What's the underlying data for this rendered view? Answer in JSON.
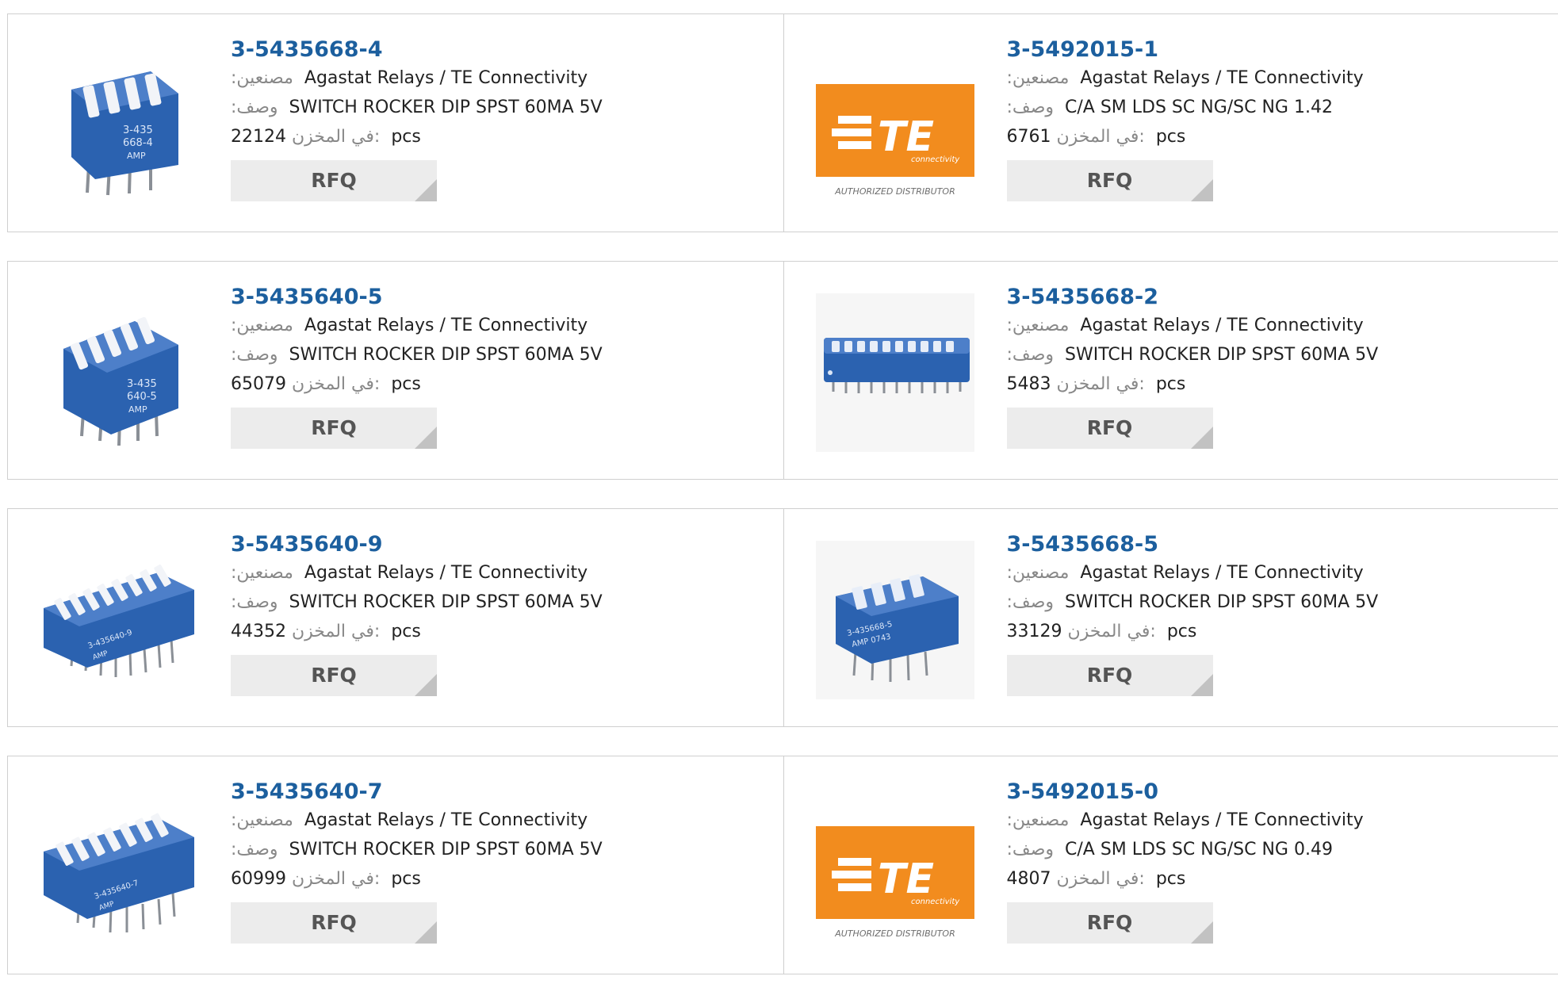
{
  "labels": {
    "manufacturer": ":مصنعين",
    "description": ":وصف",
    "stock": "في المخزن:",
    "unit": "pcs",
    "rfq": "RFQ"
  },
  "te_logo": {
    "word": "TE",
    "sub": "connectivity",
    "badge": "AUTHORIZED DISTRIBUTOR",
    "color": "#f28c1e"
  },
  "products": [
    {
      "part": "3-5435668-4",
      "manufacturer": "Agastat Relays / TE Connectivity",
      "description": "SWITCH ROCKER DIP SPST 60MA 5V",
      "stock": "22124",
      "image": "dip-switch-4",
      "image_text": [
        "3-435",
        "668-4",
        "AMP"
      ]
    },
    {
      "part": "3-5492015-1",
      "manufacturer": "Agastat Relays / TE Connectivity",
      "description": "C/A SM LDS SC NG/SC NG 1.42",
      "stock": "6761",
      "image": "te-logo"
    },
    {
      "part": "3-5435640-5",
      "manufacturer": "Agastat Relays / TE Connectivity",
      "description": "SWITCH ROCKER DIP SPST 60MA 5V",
      "stock": "65079",
      "image": "dip-switch-5",
      "image_text": [
        "3-435",
        "640-5",
        "AMP"
      ]
    },
    {
      "part": "3-5435668-2",
      "manufacturer": "Agastat Relays / TE Connectivity",
      "description": "SWITCH ROCKER DIP SPST 60MA 5V",
      "stock": "5483",
      "image": "dip-switch-long"
    },
    {
      "part": "3-5435640-9",
      "manufacturer": "Agastat Relays / TE Connectivity",
      "description": "SWITCH ROCKER DIP SPST 60MA 5V",
      "stock": "44352",
      "image": "dip-switch-9",
      "image_text": [
        "3-435640-9",
        "AMP"
      ]
    },
    {
      "part": "3-5435668-5",
      "manufacturer": "Agastat Relays / TE Connectivity",
      "description": "SWITCH ROCKER DIP SPST 60MA 5V",
      "stock": "33129",
      "image": "dip-switch-angled",
      "image_text": [
        "3-435668-5",
        "AMP 0743"
      ]
    },
    {
      "part": "3-5435640-7",
      "manufacturer": "Agastat Relays / TE Connectivity",
      "description": "SWITCH ROCKER DIP SPST 60MA 5V",
      "stock": "60999",
      "image": "dip-switch-7",
      "image_text": [
        "3-435640-7",
        "AMP"
      ]
    },
    {
      "part": "3-5492015-0",
      "manufacturer": "Agastat Relays / TE Connectivity",
      "description": "C/A SM LDS SC NG/SC NG 0.49",
      "stock": "4807",
      "image": "te-logo"
    }
  ]
}
